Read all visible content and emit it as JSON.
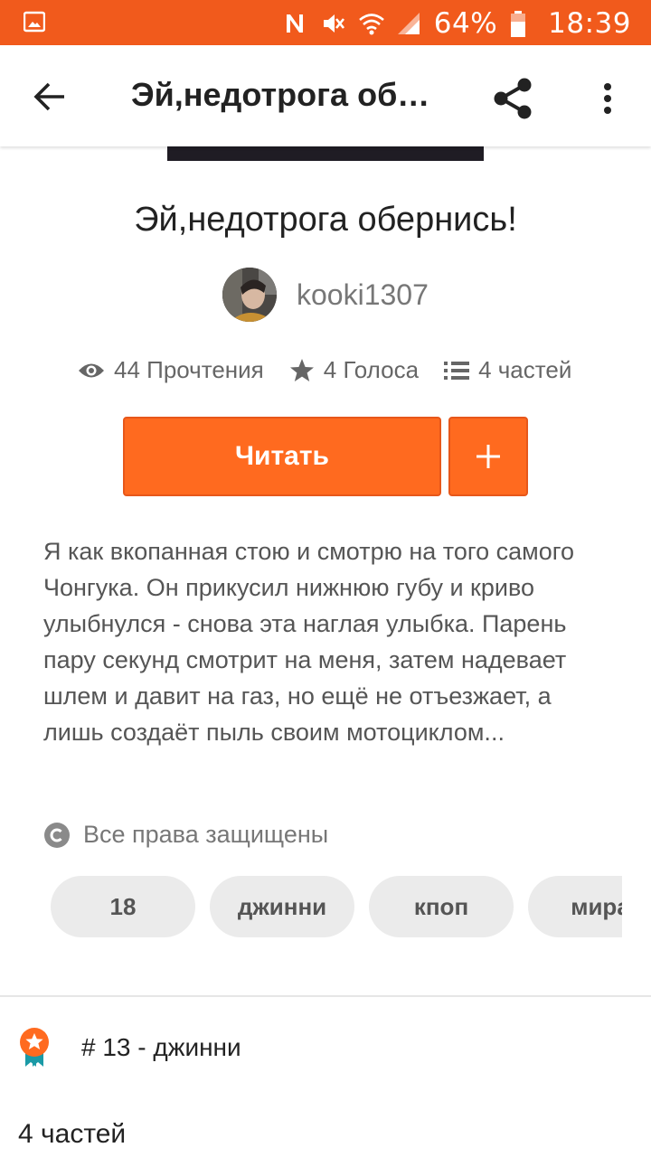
{
  "status_bar": {
    "battery_percent": "64%",
    "time": "18:39"
  },
  "appbar": {
    "title": "Эй,недотрога об…"
  },
  "story": {
    "title": "Эй,недотрога обернись!",
    "author": "kooki1307",
    "stats": {
      "reads": "44 Прочтения",
      "votes": "4 Голоса",
      "parts": "4 частей"
    },
    "read_button": "Читать",
    "description": "Я как вкопанная стою и смотрю на того самого Чонгука. Он прикусил нижнюю губу и криво улыбнулся - снова эта наглая улыбка. Парень пару секунд смотрит на меня, затем надевает шлем и давит на газ, но ещё не отъезжает, а лишь создаёт пыль своим мотоциклом...",
    "copyright": "Все права защищены",
    "tags": [
      "18",
      "джинни",
      "кпоп",
      "мира"
    ],
    "rank": "# 13 - джинни",
    "parts_heading": "4 частей"
  },
  "colors": {
    "accent": "#ff6a1f",
    "status_bar": "#f15a1c"
  }
}
